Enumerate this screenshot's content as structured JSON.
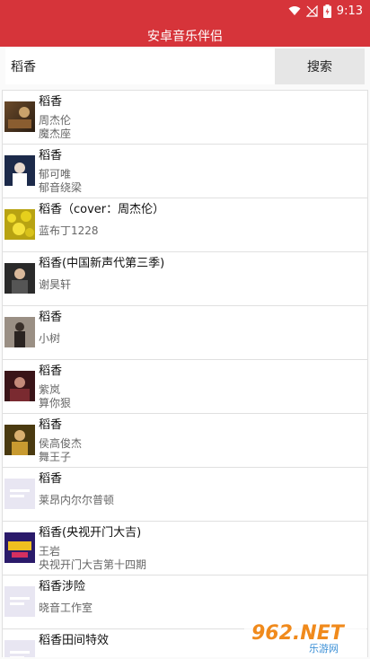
{
  "status_bar": {
    "time": "9:13"
  },
  "app": {
    "title": "安卓音乐伴侣"
  },
  "search": {
    "query": "稻香",
    "button_label": "搜索"
  },
  "results": [
    {
      "song": "稻香",
      "artist": "周杰伦",
      "album": "魔杰座"
    },
    {
      "song": "稻香",
      "artist": "郁可唯",
      "album": "郁音绕梁"
    },
    {
      "song": "稻香（cover：周杰伦）",
      "artist": "蓝布丁1228"
    },
    {
      "song": "稻香(中国新声代第三季)",
      "artist": "谢昊轩"
    },
    {
      "song": "稻香",
      "artist": "小树"
    },
    {
      "song": "稻香",
      "artist": "紫岚",
      "album": "算你狠"
    },
    {
      "song": "稻香",
      "artist": "侯高俊杰",
      "album": "舞王子"
    },
    {
      "song": "稻香",
      "artist": "莱昂内尔尔普顿"
    },
    {
      "song": "稻香(央视开门大吉)",
      "artist": "王岩",
      "album": "央视开门大吉第十四期"
    },
    {
      "song": "稻香涉险",
      "artist": "晓音工作室"
    },
    {
      "song": "稻香田间特效",
      "artist": ""
    }
  ],
  "watermark": {
    "text": "962.NET",
    "subtext": "乐游网"
  },
  "colors": {
    "app_bar": "#d6343a",
    "search_button_bg": "#e6e6e6",
    "divider": "#e0e0e0"
  }
}
